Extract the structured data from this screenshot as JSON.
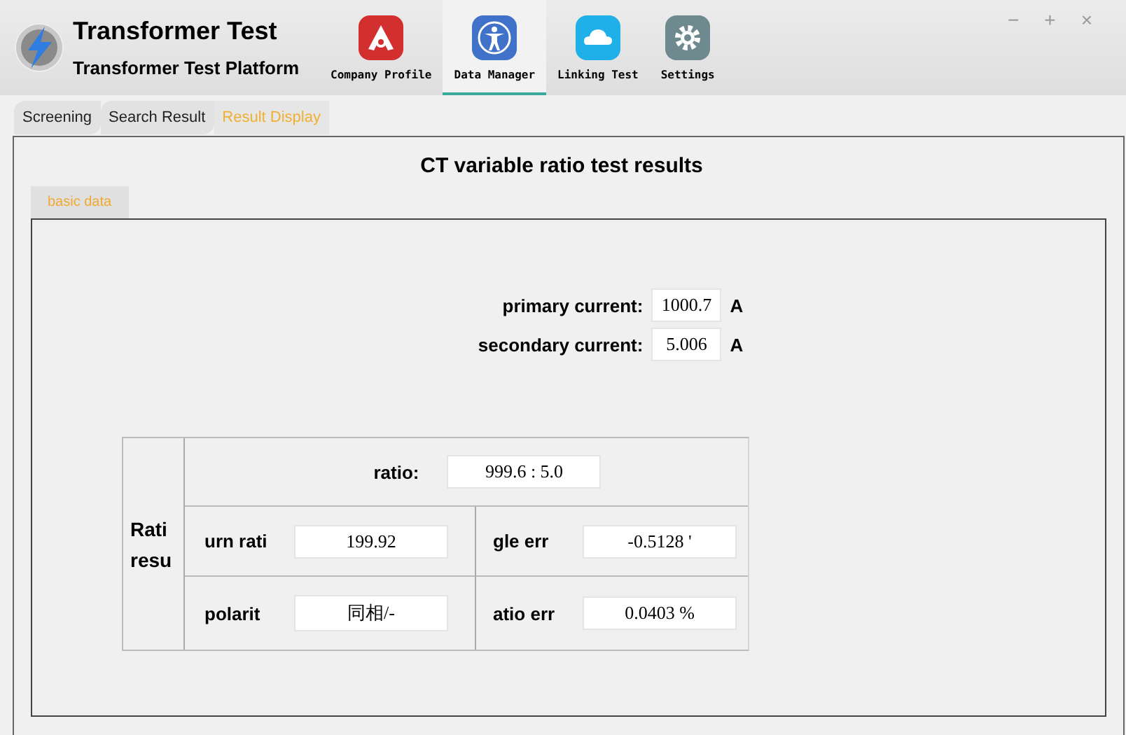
{
  "window": {
    "title": "Transformer Test",
    "subtitle": "Transformer Test Platform",
    "controls": [
      "−",
      "+",
      "×"
    ]
  },
  "nav": [
    {
      "label": "Company Profile",
      "kind": "profile",
      "selected": false
    },
    {
      "label": "Data Manager",
      "kind": "manager",
      "selected": true
    },
    {
      "label": "Linking Test",
      "kind": "cloud",
      "selected": false
    },
    {
      "label": "Settings",
      "kind": "settings",
      "selected": false
    }
  ],
  "subtabs": [
    {
      "label": "Screening",
      "selected": false
    },
    {
      "label": "Search Result",
      "selected": false
    },
    {
      "label": "Result Display",
      "selected": true
    }
  ],
  "panel": {
    "title": "CT variable ratio test results",
    "tab": "basic data",
    "currents": [
      {
        "label": "primary current:",
        "value": "1000.7",
        "unit": "A"
      },
      {
        "label": "secondary current:",
        "value": "5.006",
        "unit": "A"
      }
    ],
    "results": {
      "heading": "Rati resu",
      "ratio": {
        "label": "ratio:",
        "value": "999.6 : 5.0"
      },
      "cells": [
        {
          "label": "urn rati",
          "value": "199.92"
        },
        {
          "label": "gle err",
          "value": "-0.5128 '"
        },
        {
          "label": "polarit",
          "value": "同相/-"
        },
        {
          "label": "atio err",
          "value": "0.0403 %"
        }
      ]
    }
  }
}
